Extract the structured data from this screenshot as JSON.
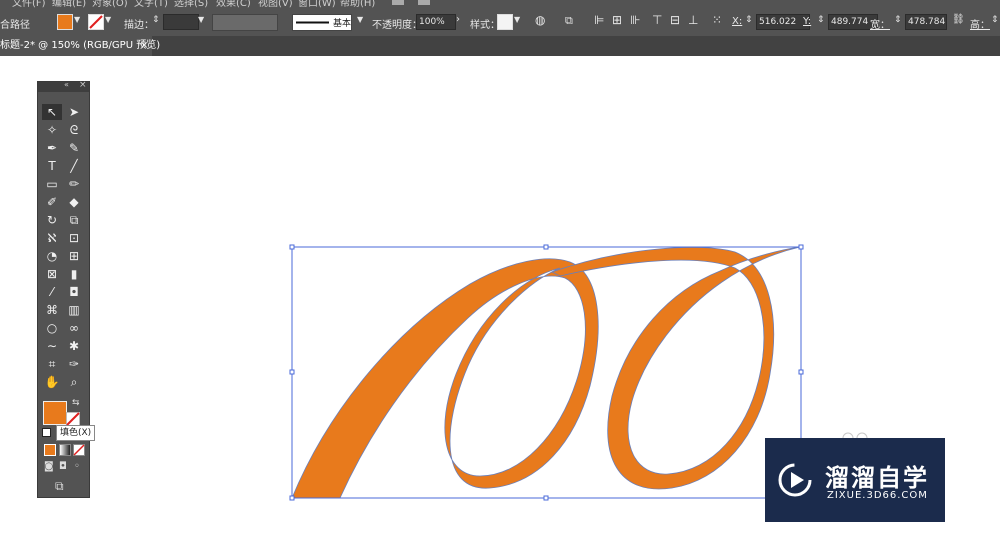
{
  "menu": {
    "items": [
      "文件(F)",
      "编辑(E)",
      "对象(O)",
      "文字(T)",
      "选择(S)",
      "效果(C)",
      "视图(V)",
      "窗口(W)",
      "帮助(H)"
    ]
  },
  "toolbar": {
    "path_label": "合路径",
    "fill_color": "#e87a1c",
    "stroke_label": "描边：",
    "stroke_style": "基本",
    "opacity_label": "不透明度：",
    "opacity_value": "100%",
    "style_label": "样式：",
    "x_label": "X:",
    "x_value": "516.022",
    "y_label": "Y:",
    "y_value": "489.774",
    "w_label": "宽：",
    "w_value": "478.784",
    "h_label": "高："
  },
  "document": {
    "tab_title": "标题-2* @ 150% (RGB/GPU 预览)",
    "tab_close": "×"
  },
  "tools": {
    "tooltip": "填色(X)"
  },
  "artwork": {
    "fill": "#e87a1c",
    "outline": "#6b7fb8",
    "selection_color": "#4a6ad8"
  },
  "watermark": {
    "brand": "溜溜自学",
    "url": "ZIXUE.3D66.COM"
  }
}
